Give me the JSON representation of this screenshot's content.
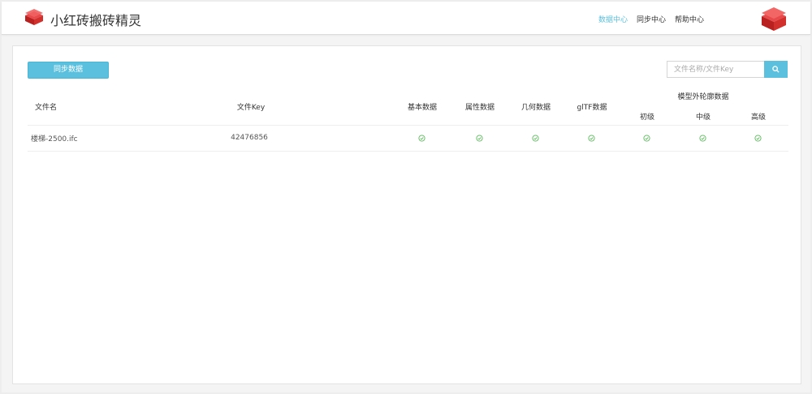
{
  "app": {
    "title": "小红砖搬砖精灵"
  },
  "nav": {
    "items": [
      "数据中心",
      "同步中心",
      "帮助中心"
    ],
    "active": 0
  },
  "toolbar": {
    "sync_label": "同步数据"
  },
  "search": {
    "placeholder": "文件名称/文件Key"
  },
  "table": {
    "headers": {
      "file_name": "文件名",
      "file_key": "文件Key",
      "basic": "基本数据",
      "attr": "属性数据",
      "geometry": "几何数据",
      "gltf": "glTF数据",
      "outline_group": "模型外轮廓数据",
      "low": "初级",
      "mid": "中级",
      "high": "高级"
    },
    "rows": [
      {
        "file_name": "楼梯-2500.ifc",
        "file_key": "42476856",
        "status": [
          "check-circle-icon",
          "check-circle-icon",
          "check-circle-icon",
          "check-circle-icon",
          "check-circle-icon",
          "check-circle-icon",
          "check-circle-icon"
        ]
      }
    ]
  },
  "colors": {
    "accent": "#5bc0de",
    "check": "#5cb85c",
    "brand": "#d9302c"
  }
}
